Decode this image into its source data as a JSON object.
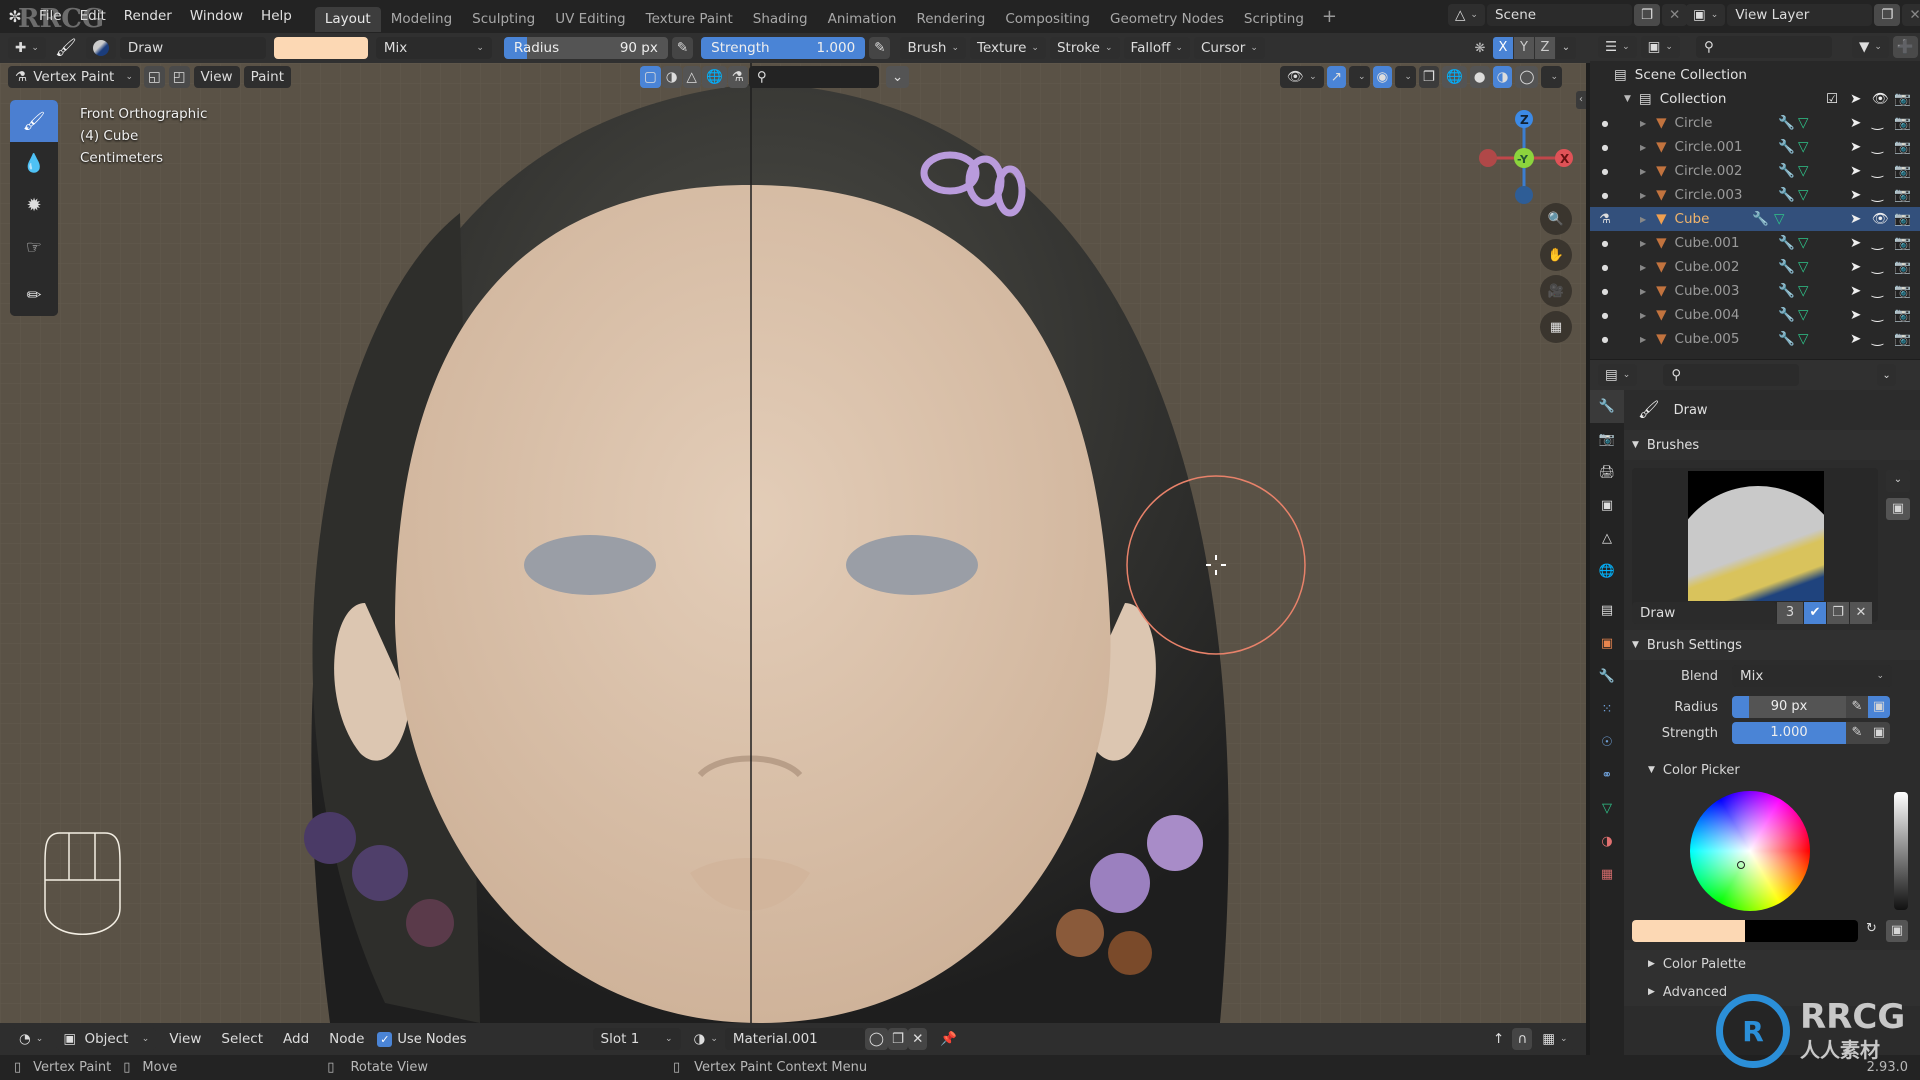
{
  "menubar": {
    "items": [
      "File",
      "Edit",
      "Render",
      "Window",
      "Help"
    ],
    "workspaces": [
      "Layout",
      "Modeling",
      "Sculpting",
      "UV Editing",
      "Texture Paint",
      "Shading",
      "Animation",
      "Rendering",
      "Compositing",
      "Geometry Nodes",
      "Scripting"
    ],
    "active_workspace": "Layout",
    "add_workspace": "+",
    "scene": "Scene",
    "view_layer": "View Layer"
  },
  "tool_header": {
    "brush_name": "Draw",
    "brush_color": "#fcd8b4",
    "blend": "Mix",
    "radius_label": "Radius",
    "radius_value": "90 px",
    "strength_label": "Strength",
    "strength_value": "1.000",
    "menus": [
      "Brush",
      "Texture",
      "Stroke",
      "Falloff",
      "Cursor"
    ],
    "mirror_axes": [
      "X",
      "Y",
      "Z"
    ],
    "active_axis": "X"
  },
  "viewport_header": {
    "mode": "Vertex Paint",
    "menus": [
      "View",
      "Paint"
    ]
  },
  "viewport": {
    "view_name": "Front Orthographic",
    "object_info": "(4) Cube",
    "units": "Centimeters",
    "gizmo": {
      "z": "Z",
      "y": "-Y",
      "x": "X"
    }
  },
  "outliner": {
    "root": "Scene Collection",
    "collection": "Collection",
    "objects": [
      {
        "name": "Circle",
        "selected": false
      },
      {
        "name": "Circle.001",
        "selected": false
      },
      {
        "name": "Circle.002",
        "selected": false
      },
      {
        "name": "Circle.003",
        "selected": false
      },
      {
        "name": "Cube",
        "selected": true
      },
      {
        "name": "Cube.001",
        "selected": false
      },
      {
        "name": "Cube.002",
        "selected": false
      },
      {
        "name": "Cube.003",
        "selected": false
      },
      {
        "name": "Cube.004",
        "selected": false
      },
      {
        "name": "Cube.005",
        "selected": false
      }
    ]
  },
  "properties": {
    "tool_name": "Draw",
    "brushes_panel": "Brushes",
    "brush_datablock": "Draw",
    "brush_users": "3",
    "brush_settings_panel": "Brush Settings",
    "blend_label": "Blend",
    "blend_value": "Mix",
    "radius_label": "Radius",
    "radius_value": "90 px",
    "strength_label": "Strength",
    "strength_value": "1.000",
    "color_picker_panel": "Color Picker",
    "primary_color": "#fcd8b4",
    "secondary_color": "#000000",
    "color_palette_panel": "Color Palette",
    "advanced_panel": "Advanced"
  },
  "bottom_header": {
    "editor_mode": "Object",
    "menus": [
      "View",
      "Select",
      "Add",
      "Node"
    ],
    "use_nodes_label": "Use Nodes",
    "use_nodes_checked": true,
    "slot": "Slot 1",
    "material": "Material.001"
  },
  "statusbar": {
    "left_click": "Vertex Paint",
    "middle_click": "Move",
    "rotate": "Rotate View",
    "right_click": "Vertex Paint Context Menu",
    "version": "2.93.0"
  },
  "watermark": {
    "text": "RRCG",
    "subtext": "人人素材"
  }
}
